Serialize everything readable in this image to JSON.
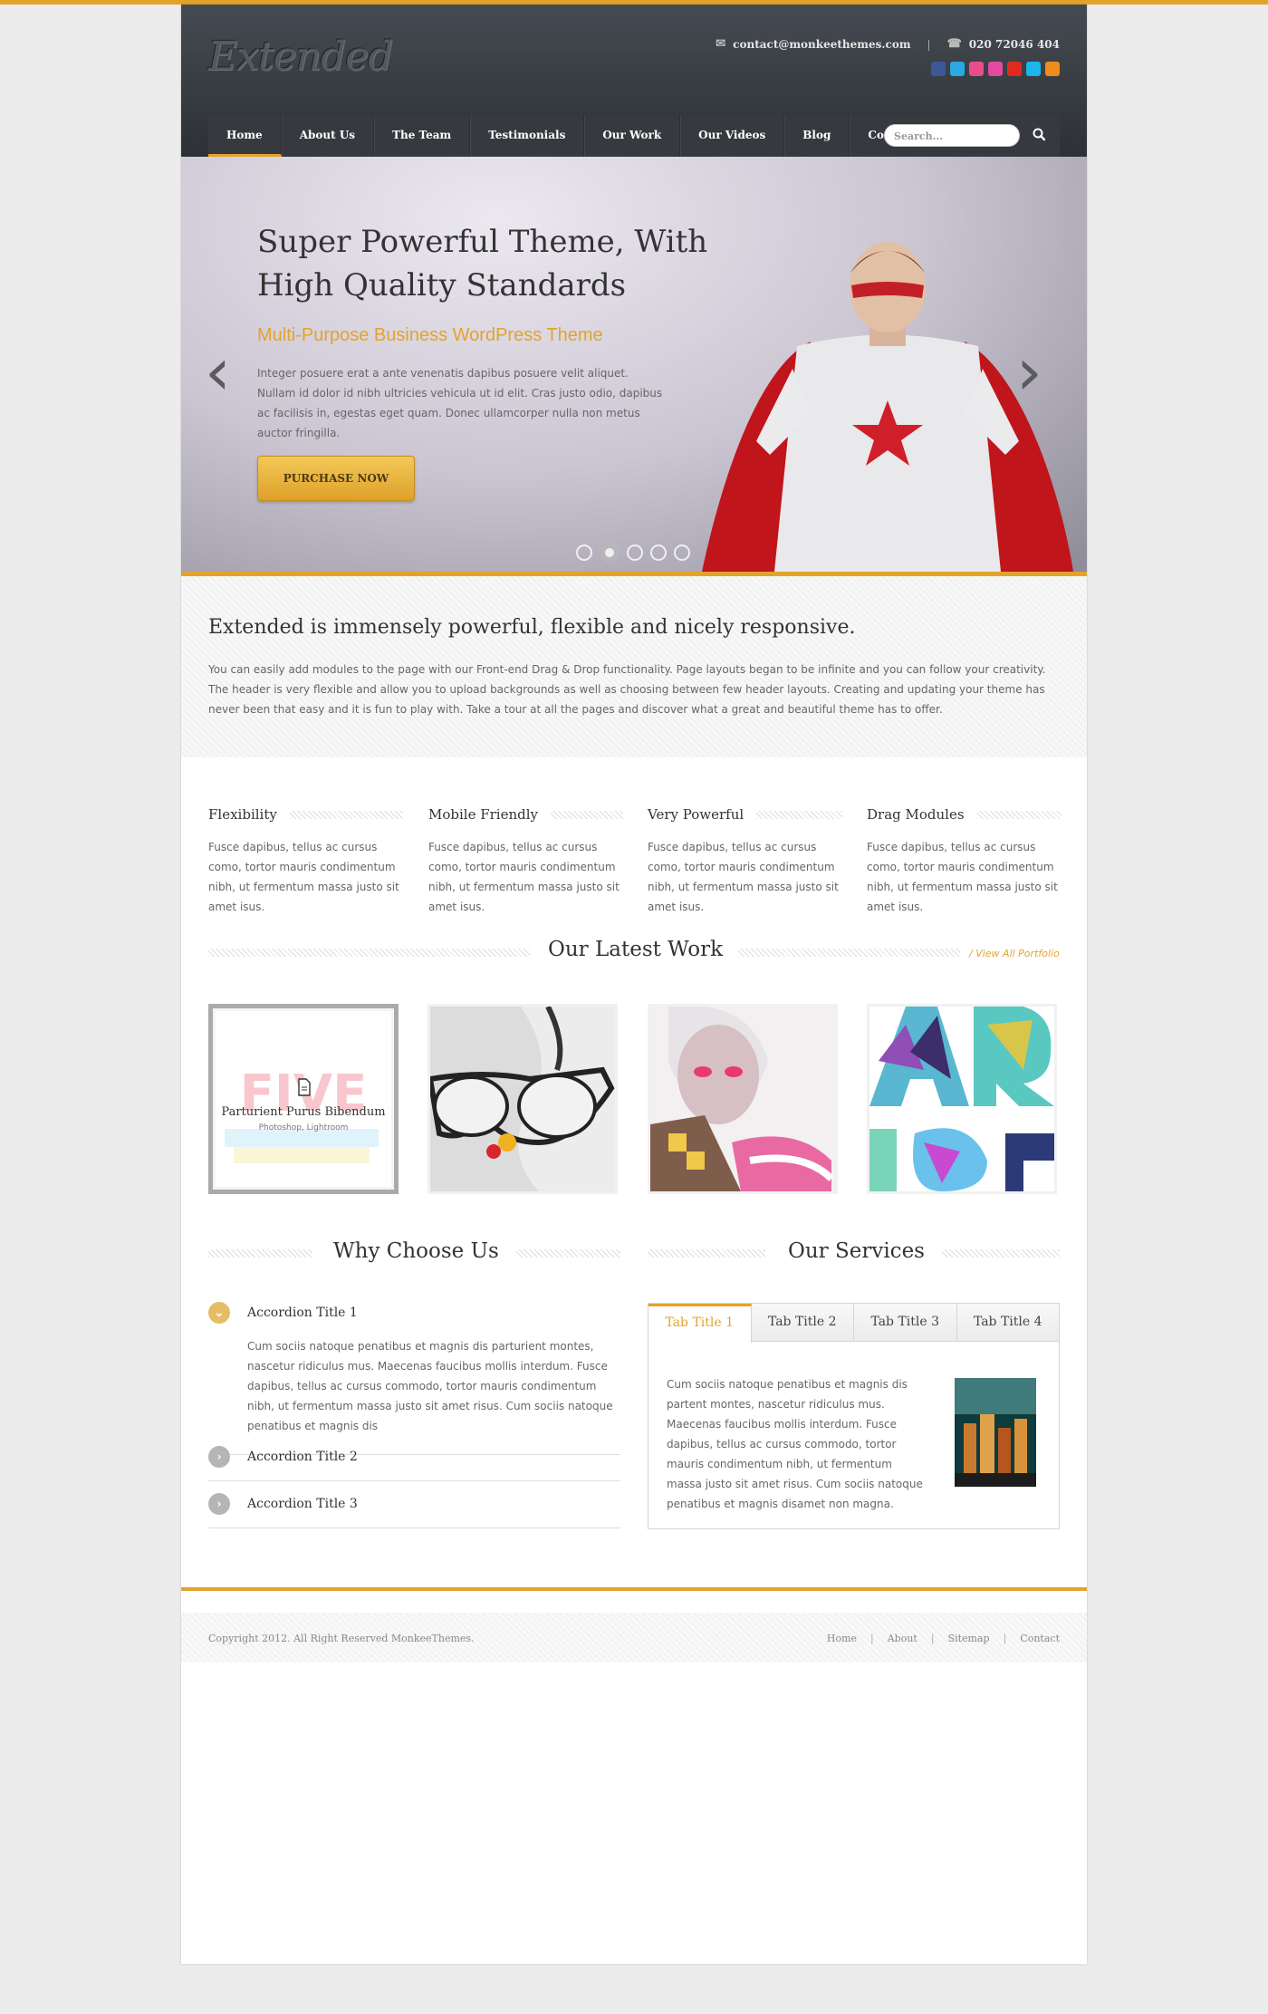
{
  "header": {
    "logo": "Extended",
    "email": "contact@monkeethemes.com",
    "phone": "020 72046 404",
    "social": [
      {
        "name": "facebook-icon",
        "color": "#3b5998"
      },
      {
        "name": "twitter-icon",
        "color": "#29a9e1"
      },
      {
        "name": "dribbble-icon",
        "color": "#ea4c89"
      },
      {
        "name": "flickr-icon",
        "color": "#e24aa0"
      },
      {
        "name": "youtube-icon",
        "color": "#e02a20"
      },
      {
        "name": "vimeo-icon",
        "color": "#1ab7ea"
      },
      {
        "name": "rss-icon",
        "color": "#f08c1b"
      }
    ]
  },
  "nav": {
    "items": [
      "Home",
      "About Us",
      "The Team",
      "Testimonials",
      "Our Work",
      "Our Videos",
      "Blog",
      "Contact"
    ],
    "search_placeholder": "Search..."
  },
  "hero": {
    "title": "Super Powerful Theme, With High Quality Standards",
    "subtitle": "Multi-Purpose Business WordPress Theme",
    "text": "Integer posuere erat a ante venenatis dapibus posuere velit aliquet. Nullam id dolor id nibh ultricies vehicula ut id elit. Cras justo odio, dapibus ac facilisis in, egestas eget quam. Donec ullamcorper nulla non metus auctor fringilla.",
    "button": "PURCHASE NOW",
    "slides": 5,
    "active_slide": 2
  },
  "intro": {
    "heading": "Extended is immensely powerful, flexible and nicely responsive.",
    "text": "You can easily add modules to the page with our Front-end Drag & Drop functionality. Page layouts began to be infinite and you can follow your creativity. The header is very flexible and allow you to upload backgrounds as well as choosing between few header layouts. Creating and updating your theme has never been that easy and it is fun to play with. Take a tour at all the pages and discover what a great and beautiful theme has to offer."
  },
  "features": [
    {
      "title": "Flexibility",
      "text": "Fusce dapibus, tellus ac cursus como, tortor mauris condimentum nibh, ut fermentum massa justo sit amet isus."
    },
    {
      "title": "Mobile Friendly",
      "text": "Fusce dapibus, tellus ac cursus como, tortor mauris condimentum nibh, ut fermentum massa justo sit amet isus."
    },
    {
      "title": "Very Powerful",
      "text": "Fusce dapibus, tellus ac cursus como, tortor mauris condimentum nibh, ut fermentum massa justo sit amet isus."
    },
    {
      "title": "Drag Modules",
      "text": "Fusce dapibus, tellus ac cursus como, tortor mauris condimentum nibh, ut fermentum massa justo sit amet isus."
    }
  ],
  "work": {
    "title": "Our Latest Work",
    "view_all": "/ View All Portfolio",
    "hover_title": "Parturient Purus Bibendum",
    "hover_sub": "Photoshop, Lightroom"
  },
  "why": {
    "title": "Why Choose Us",
    "accordion": [
      {
        "title": "Accordion Title 1",
        "text": "Cum sociis natoque penatibus et magnis dis parturient montes, nascetur ridiculus mus. Maecenas faucibus mollis interdum. Fusce dapibus, tellus ac cursus commodo, tortor mauris condimentum nibh, ut fermentum massa justo sit amet risus. Cum sociis natoque penatibus et magnis dis"
      },
      {
        "title": "Accordion Title 2"
      },
      {
        "title": "Accordion Title 3"
      }
    ]
  },
  "services": {
    "title": "Our Services",
    "tabs": [
      "Tab Title 1",
      "Tab Title 2",
      "Tab Title 3",
      "Tab Title 4"
    ],
    "text": "Cum sociis natoque penatibus et magnis dis partent montes, nascetur ridiculus mus. Maecenas faucibus mollis interdum. Fusce dapibus, tellus ac cursus commodo, tortor mauris condimentum nibh, ut fermentum massa justo sit amet risus. Cum sociis natoque penatibus et magnis disamet non magna."
  },
  "footer": {
    "copyright": "Copyright 2012. All Right Reserved MonkeeThemes.",
    "links": [
      "Home",
      "About",
      "Sitemap",
      "Contact"
    ]
  },
  "colors": {
    "accent": "#e3a32b",
    "header": "#383c41"
  }
}
